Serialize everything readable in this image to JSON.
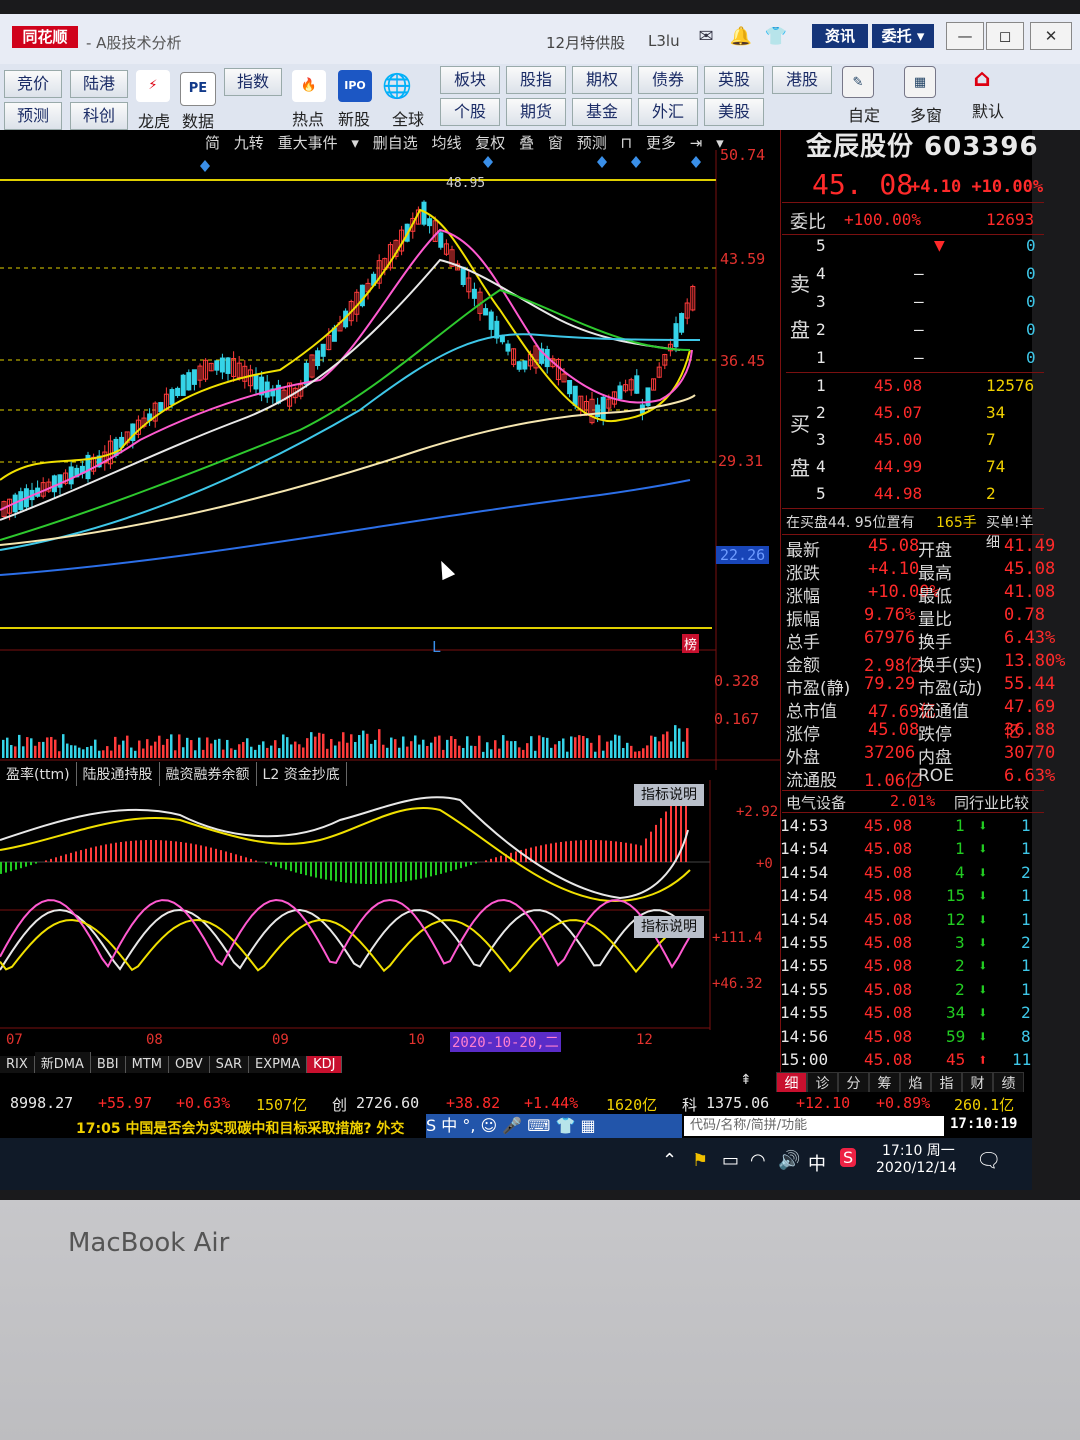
{
  "titlebar": {
    "logo": "同花顺",
    "title": "- A股技术分析",
    "center_text": "12月特供股",
    "lv_text": "L3lu",
    "btn_news": "资讯",
    "btn_order": "委托",
    "icons": [
      "mail-icon",
      "bell-icon",
      "shirt-icon"
    ],
    "win_min": "—",
    "win_max": "◻",
    "win_close": "✕"
  },
  "toolbar": {
    "row1": [
      "竞价",
      "陆港"
    ],
    "row2": [
      "预测",
      "科创"
    ],
    "icon_labels": [
      "龙虎",
      "数据",
      "热点",
      "新股",
      "全球"
    ],
    "icon_marks": [
      "⚡",
      "PE",
      "🔥",
      "IPO",
      "🌐"
    ],
    "grid_buttons_row1": [
      "指数",
      "板块",
      "股指",
      "期权",
      "债券",
      "英股",
      "港股"
    ],
    "grid_buttons_row2": [
      "个股",
      "期货",
      "基金",
      "外汇",
      "美股"
    ],
    "right_labels": [
      "自定",
      "多窗",
      "默认"
    ]
  },
  "chart_tabs": [
    "简",
    "九转",
    "重大事件",
    "▾",
    "删自选",
    "均线",
    "复权",
    "叠",
    "窗",
    "预测",
    "⊓",
    "更多",
    "⇥",
    "▾"
  ],
  "stock": {
    "name": "金辰股份 603396",
    "price": "45. 08",
    "change": "+4.10",
    "change_pct": "+10.00%",
    "weibi_label": "委比",
    "weibi_value": "+100.00%",
    "weibi_count": "12693"
  },
  "price_axis": [
    "50.74",
    "43.59",
    "36.45",
    "29.31",
    "22.26"
  ],
  "peak_label": "48.95",
  "volume_axis": [
    "0.328",
    "0.167"
  ],
  "sell_side_label": [
    "卖",
    "盘"
  ],
  "buy_side_label": [
    "买",
    "盘"
  ],
  "sell_orders": [
    {
      "level": "5",
      "price": "",
      "qty": "0"
    },
    {
      "level": "4",
      "price": "—",
      "qty": "0"
    },
    {
      "level": "3",
      "price": "—",
      "qty": "0"
    },
    {
      "level": "2",
      "price": "—",
      "qty": "0"
    },
    {
      "level": "1",
      "price": "—",
      "qty": "0"
    }
  ],
  "buy_orders": [
    {
      "level": "1",
      "price": "45.08",
      "qty": "12576"
    },
    {
      "level": "2",
      "price": "45.07",
      "qty": "34"
    },
    {
      "level": "3",
      "price": "45.00",
      "qty": "7"
    },
    {
      "level": "4",
      "price": "44.99",
      "qty": "74"
    },
    {
      "level": "5",
      "price": "44.98",
      "qty": "2"
    }
  ],
  "inbuy_note": "在买盘44. 95位置有",
  "inbuy_qty": "165手",
  "inbuy_right": "买单!羊细",
  "stats": [
    {
      "l1": "最新",
      "v1": "45.08",
      "l2": "开盘",
      "v2": "41.49"
    },
    {
      "l1": "涨跌",
      "v1": "+4.10",
      "l2": "最高",
      "v2": "45.08"
    },
    {
      "l1": "涨幅",
      "v1": "+10.00%",
      "l2": "最低",
      "v2": "41.08"
    },
    {
      "l1": "振幅",
      "v1": "9.76%",
      "l2": "量比",
      "v2": "0.78"
    },
    {
      "l1": "总手",
      "v1": "67976",
      "l2": "换手",
      "v2": "6.43%"
    },
    {
      "l1": "金额",
      "v1": "2.98亿",
      "l2": "换手(实)",
      "v2": "13.80%"
    },
    {
      "l1": "市盈(静)",
      "v1": "79.29",
      "l2": "市盈(动)",
      "v2": "55.44"
    },
    {
      "l1": "总市值",
      "v1": "47.69亿",
      "l2": "流通值",
      "v2": "47.69亿"
    },
    {
      "l1": "涨停",
      "v1": "45.08",
      "l2": "跌停",
      "v2": "36.88"
    },
    {
      "l1": "外盘",
      "v1": "37206",
      "l2": "内盘",
      "v2": "30770"
    },
    {
      "l1": "流通股",
      "v1": "1.06亿",
      "l2": "ROE",
      "v2": "6.63%"
    }
  ],
  "sector": {
    "name": "电气设备",
    "pct": "2.01%",
    "compare": "同行业比较"
  },
  "ticks": [
    {
      "t": "14:53",
      "p": "45.08",
      "v": "1",
      "d": "down",
      "n": "1"
    },
    {
      "t": "14:54",
      "p": "45.08",
      "v": "1",
      "d": "down",
      "n": "1"
    },
    {
      "t": "14:54",
      "p": "45.08",
      "v": "4",
      "d": "down",
      "n": "2"
    },
    {
      "t": "14:54",
      "p": "45.08",
      "v": "15",
      "d": "down",
      "n": "1"
    },
    {
      "t": "14:54",
      "p": "45.08",
      "v": "12",
      "d": "down",
      "n": "1"
    },
    {
      "t": "14:55",
      "p": "45.08",
      "v": "3",
      "d": "down",
      "n": "2"
    },
    {
      "t": "14:55",
      "p": "45.08",
      "v": "2",
      "d": "down",
      "n": "1"
    },
    {
      "t": "14:55",
      "p": "45.08",
      "v": "2",
      "d": "down",
      "n": "1"
    },
    {
      "t": "14:55",
      "p": "45.08",
      "v": "34",
      "d": "down",
      "n": "2"
    },
    {
      "t": "14:56",
      "p": "45.08",
      "v": "59",
      "d": "down",
      "n": "8"
    },
    {
      "t": "15:00",
      "p": "45.08",
      "v": "45",
      "d": "up",
      "n": "11"
    }
  ],
  "sub_tabs": [
    "盈率(ttm)",
    "陆股通持股",
    "融资融券余额",
    "L2 资金抄底"
  ],
  "indicator_btn": "指标说明",
  "macd_axis": [
    "+2.92",
    "+0"
  ],
  "kdj_axis": [
    "+111.4",
    "+46.32"
  ],
  "months": [
    "07",
    "08",
    "09",
    "10",
    "12"
  ],
  "cursor_date": "2020-10-20,二",
  "bottom_tabs": [
    "RIX",
    "新DMA",
    "BBI",
    "MTM",
    "OBV",
    "SAR",
    "EXPMA",
    "KDJ"
  ],
  "right_tabs": [
    "细",
    "诊",
    "分",
    "筹",
    "焰",
    "指",
    "财",
    "绩"
  ],
  "index_bar": {
    "sh_val": "8998.27",
    "sh_chg": "+55.97",
    "sh_pct": "+0.63%",
    "sh_amt": "1507亿",
    "cy_name": "创",
    "cy_val": "2726.60",
    "cy_chg": "+38.82",
    "cy_pct": "+1.44%",
    "cy_amt": "1620亿",
    "kc_name": "科",
    "kc_val": "1375.06",
    "kc_chg": "+12.10",
    "kc_pct": "+0.89%",
    "kc_amt": "260.1亿"
  },
  "news": "17:05 中国是否会为实现碳中和目标采取措施? 外交",
  "search_placeholder": "代码/名称/简拼/功能",
  "clock_small": "17:10:19",
  "taskbar": {
    "time": "17:10 周一",
    "date": "2020/12/14",
    "ime": "中"
  },
  "macbook_label": "MacBook Air",
  "marker_letter": "L",
  "bang": "榜",
  "colors": {
    "up": "#ff2a2a",
    "down": "#22cc22",
    "accent": "#f0d000",
    "bg": "#000000"
  }
}
